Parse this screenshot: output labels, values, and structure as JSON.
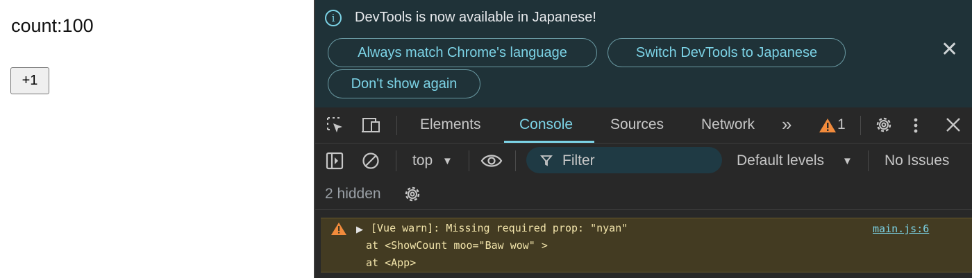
{
  "page": {
    "count_text": "count:100",
    "button_label": "+1"
  },
  "infobar": {
    "message": "DevTools is now available in Japanese!",
    "info_icon_glyph": "i",
    "buttons": [
      "Always match Chrome's language",
      "Switch DevTools to Japanese",
      "Don't show again"
    ],
    "close_glyph": "✕"
  },
  "tabs": {
    "items": [
      "Elements",
      "Console",
      "Sources",
      "Network"
    ],
    "active": "Console",
    "more_glyph": "»",
    "warning_count": "1"
  },
  "console_toolbar": {
    "context": "top",
    "filter_placeholder": "Filter",
    "levels": "Default levels",
    "issues": "No Issues"
  },
  "hidden": {
    "text": "2 hidden"
  },
  "messages": [
    {
      "level": "warning",
      "lines": [
        "[Vue warn]: Missing required prop: \"nyan\"",
        "at <ShowCount moo=\"Baw wow\" >",
        "at <App>"
      ],
      "source": "main.js:6"
    }
  ],
  "colors": {
    "accent": "#7cd3e6",
    "warning_bg": "#433b22",
    "warning_icon": "#f28b3c",
    "infobar_bg": "#1f3238",
    "devtools_bg": "#282828"
  }
}
